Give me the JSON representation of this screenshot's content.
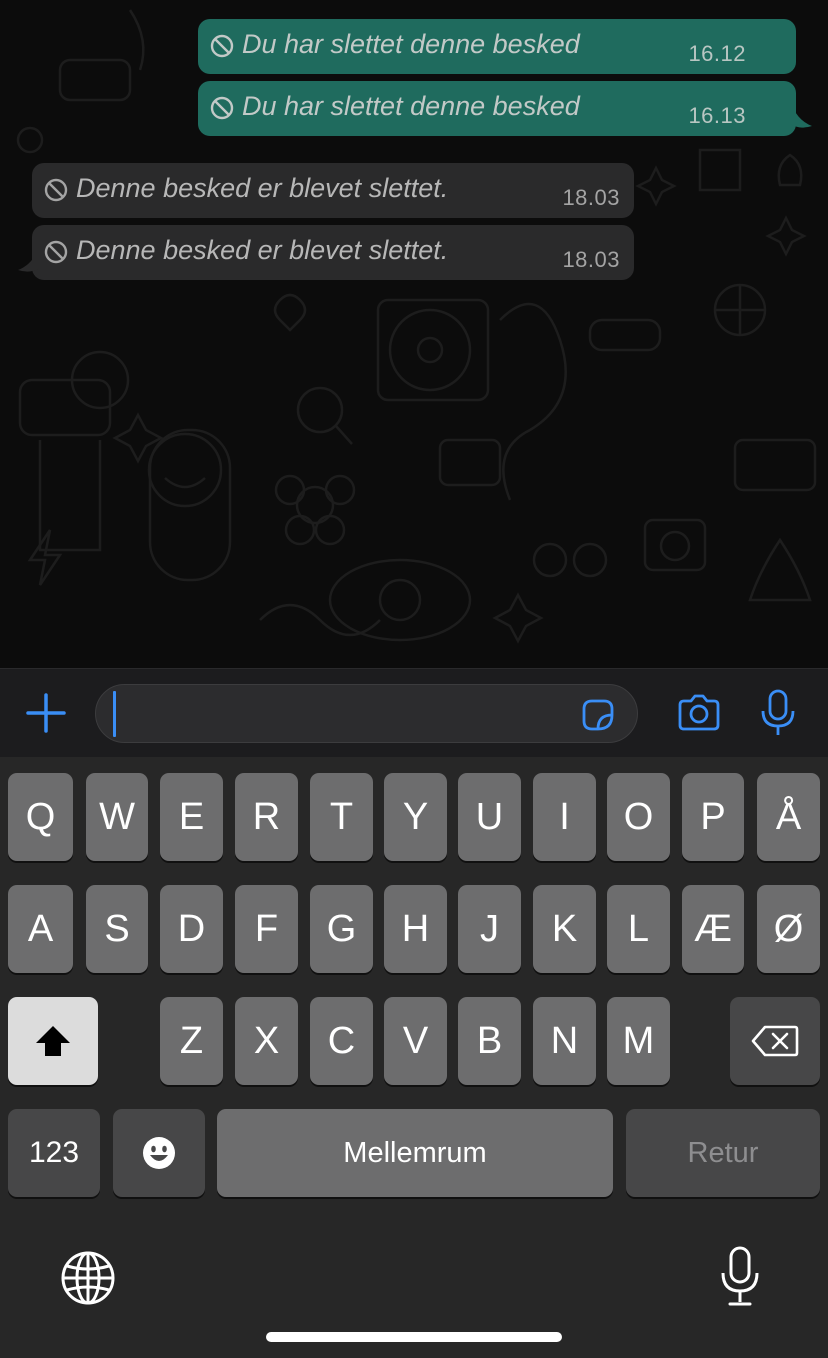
{
  "messages": [
    {
      "direction": "outgoing",
      "text": "Du har slettet denne besked",
      "time": "16.12"
    },
    {
      "direction": "outgoing",
      "text": "Du har slettet denne besked",
      "time": "16.13"
    },
    {
      "direction": "incoming",
      "text": "Denne besked er blevet slettet.",
      "time": "18.03"
    },
    {
      "direction": "incoming",
      "text": "Denne besked er blevet slettet.",
      "time": "18.03"
    }
  ],
  "composer": {
    "attach_icon": "plus-icon",
    "input_value": "",
    "sticker_icon": "sticker-icon",
    "camera_icon": "camera-icon",
    "mic_icon": "microphone-icon",
    "accent_color": "#3a8ef6"
  },
  "keyboard": {
    "row1": [
      "Q",
      "W",
      "E",
      "R",
      "T",
      "Y",
      "U",
      "I",
      "O",
      "P",
      "Å"
    ],
    "row2": [
      "A",
      "S",
      "D",
      "F",
      "G",
      "H",
      "J",
      "K",
      "L",
      "Æ",
      "Ø"
    ],
    "row3": [
      "Z",
      "X",
      "C",
      "V",
      "B",
      "N",
      "M"
    ],
    "numbers_label": "123",
    "space_label": "Mellemrum",
    "return_label": "Retur",
    "shift_icon": "shift-icon",
    "delete_icon": "backspace-icon",
    "emoji_icon": "emoji-icon",
    "globe_icon": "globe-icon",
    "dictation_icon": "microphone-icon"
  },
  "colors": {
    "outgoing_bubble": "#1f6b5e",
    "incoming_bubble": "#2a2a2b",
    "keyboard_bg": "#272727"
  }
}
